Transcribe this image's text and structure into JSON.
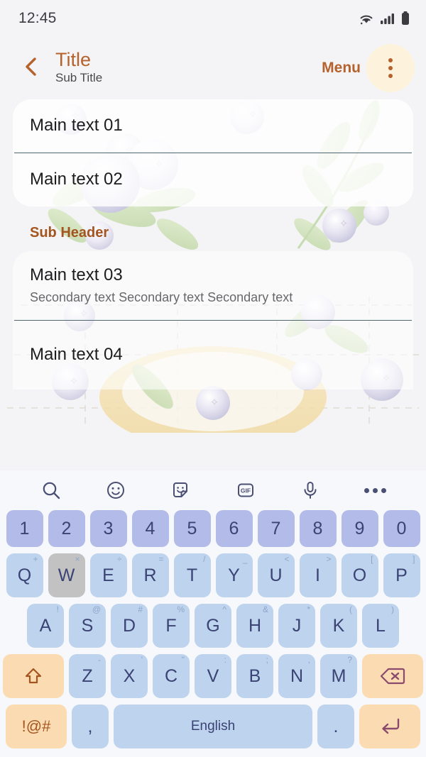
{
  "statusbar": {
    "time": "12:45",
    "icons": [
      "wifi-icon",
      "signal-icon",
      "battery-icon"
    ]
  },
  "appbar": {
    "back_icon": "chevron-left-icon",
    "title": "Title",
    "subtitle": "Sub Title",
    "menu_label": "Menu",
    "overflow_icon": "overflow-menu-icon",
    "accent_color": "#b5622c",
    "overflow_highlight_color": "#fdf3dd"
  },
  "list": {
    "card_one": [
      {
        "main": "Main text 01"
      },
      {
        "main": "Main text 02"
      }
    ],
    "sub_header": "Sub Header",
    "sub_header_color": "#a4541f",
    "card_two": [
      {
        "main": "Main text 03",
        "secondary": "Secondary text Secondary text Secondary text"
      },
      {
        "main": "Main text 04"
      }
    ],
    "divider_color": "#4f6670"
  },
  "keyboard": {
    "background": "#f7f8fb",
    "toolbar": [
      {
        "name": "search-icon",
        "label": "Search"
      },
      {
        "name": "emoji-icon",
        "label": "Emoji"
      },
      {
        "name": "sticker-icon",
        "label": "Sticker"
      },
      {
        "name": "gif-icon",
        "label": "GIF"
      },
      {
        "name": "microphone-icon",
        "label": "Voice input"
      },
      {
        "name": "more-options-icon",
        "label": "More"
      }
    ],
    "gif_label": "GIF",
    "number_row": [
      "1",
      "2",
      "3",
      "4",
      "5",
      "6",
      "7",
      "8",
      "9",
      "0"
    ],
    "row_q": [
      {
        "key": "Q",
        "sup": "+"
      },
      {
        "key": "W",
        "sup": "×",
        "pressed": true
      },
      {
        "key": "E",
        "sup": "÷"
      },
      {
        "key": "R",
        "sup": "="
      },
      {
        "key": "T",
        "sup": "/"
      },
      {
        "key": "Y",
        "sup": "_"
      },
      {
        "key": "U",
        "sup": "<"
      },
      {
        "key": "I",
        "sup": ">"
      },
      {
        "key": "O",
        "sup": "["
      },
      {
        "key": "P",
        "sup": "]"
      }
    ],
    "row_a": [
      {
        "key": "A",
        "sup": "!"
      },
      {
        "key": "S",
        "sup": "@"
      },
      {
        "key": "D",
        "sup": "#"
      },
      {
        "key": "F",
        "sup": "%"
      },
      {
        "key": "G",
        "sup": "^"
      },
      {
        "key": "H",
        "sup": "&"
      },
      {
        "key": "J",
        "sup": "*"
      },
      {
        "key": "K",
        "sup": "("
      },
      {
        "key": "L",
        "sup": ")"
      }
    ],
    "row_z": [
      {
        "key": "Z",
        "sup": "-"
      },
      {
        "key": "X",
        "sup": "'"
      },
      {
        "key": "C",
        "sup": "\""
      },
      {
        "key": "V",
        "sup": ":"
      },
      {
        "key": "B",
        "sup": ";"
      },
      {
        "key": "N",
        "sup": ","
      },
      {
        "key": "M",
        "sup": "?"
      }
    ],
    "shift_icon": "shift-arrow-icon",
    "backspace_icon": "backspace-icon",
    "symbols_label": "!@#",
    "comma_label": ",",
    "space_label": "English",
    "period_label": ".",
    "enter_icon": "enter-return-icon",
    "key_color": "#bdd3ee",
    "number_key_color": "#b3bce8",
    "accent_key_color": "#fbdcb2",
    "pressed_key_color": "#c2c2c2",
    "key_text_color": "#3b4374"
  }
}
